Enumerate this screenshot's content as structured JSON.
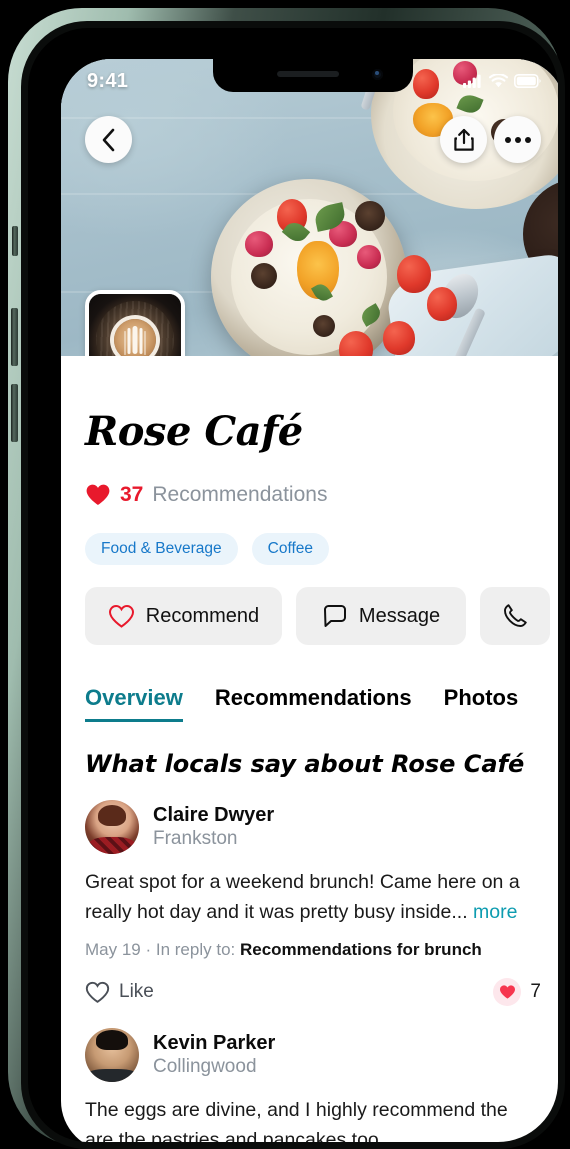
{
  "status_bar": {
    "time": "9:41",
    "icons": [
      "cellular-signal-icon",
      "wifi-icon",
      "battery-icon"
    ]
  },
  "hero": {
    "alt": "Overhead photo of two breakfast bowls with berries, orange slices and star anise on a pale blue table",
    "back_icon": "chevron-left-icon",
    "share_icon": "share-icon",
    "more_icon": "more-horizontal-icon"
  },
  "logo": {
    "alt": "Latte art coffee cup on a dark round wooden board"
  },
  "venue": {
    "title": "Rose Café",
    "recommendations_count": "37",
    "recommendations_label": "Recommendations",
    "heart_icon": "heart-filled-icon",
    "accent_red": "#e8192c"
  },
  "tags": [
    {
      "label": "Food & Beverage"
    },
    {
      "label": "Coffee"
    }
  ],
  "actions": [
    {
      "name": "recommend",
      "label": "Recommend",
      "icon": "heart-outline-icon"
    },
    {
      "name": "message",
      "label": "Message",
      "icon": "chat-bubble-icon"
    },
    {
      "name": "call",
      "label": "",
      "icon": "phone-icon"
    }
  ],
  "tabs": [
    {
      "label": "Overview",
      "active": true
    },
    {
      "label": "Recommendations",
      "active": false
    },
    {
      "label": "Photos",
      "active": false
    }
  ],
  "overview": {
    "heading": "What locals say about Rose Café"
  },
  "reviews": [
    {
      "name": "Claire Dwyer",
      "location": "Frankston",
      "text": "Great spot for a weekend brunch! Came here on a really hot day and it was pretty busy inside...",
      "more_label": "more",
      "date": "May 19",
      "reply_prefix": "· In reply to:",
      "reply_target": "Recommendations for brunch",
      "like_label": "Like",
      "like_icon": "heart-outline-icon",
      "like_count": "7",
      "like_count_icon": "heart-filled-icon"
    },
    {
      "name": "Kevin Parker",
      "location": "Collingwood",
      "text": "The eggs are divine, and I highly recommend the are the pastries and pancakes too."
    }
  ],
  "theme": {
    "accent_teal": "#0d7c8c",
    "link_blue": "#1778c9",
    "tag_bg": "#eaf4fb",
    "muted_text": "#8b939c"
  }
}
